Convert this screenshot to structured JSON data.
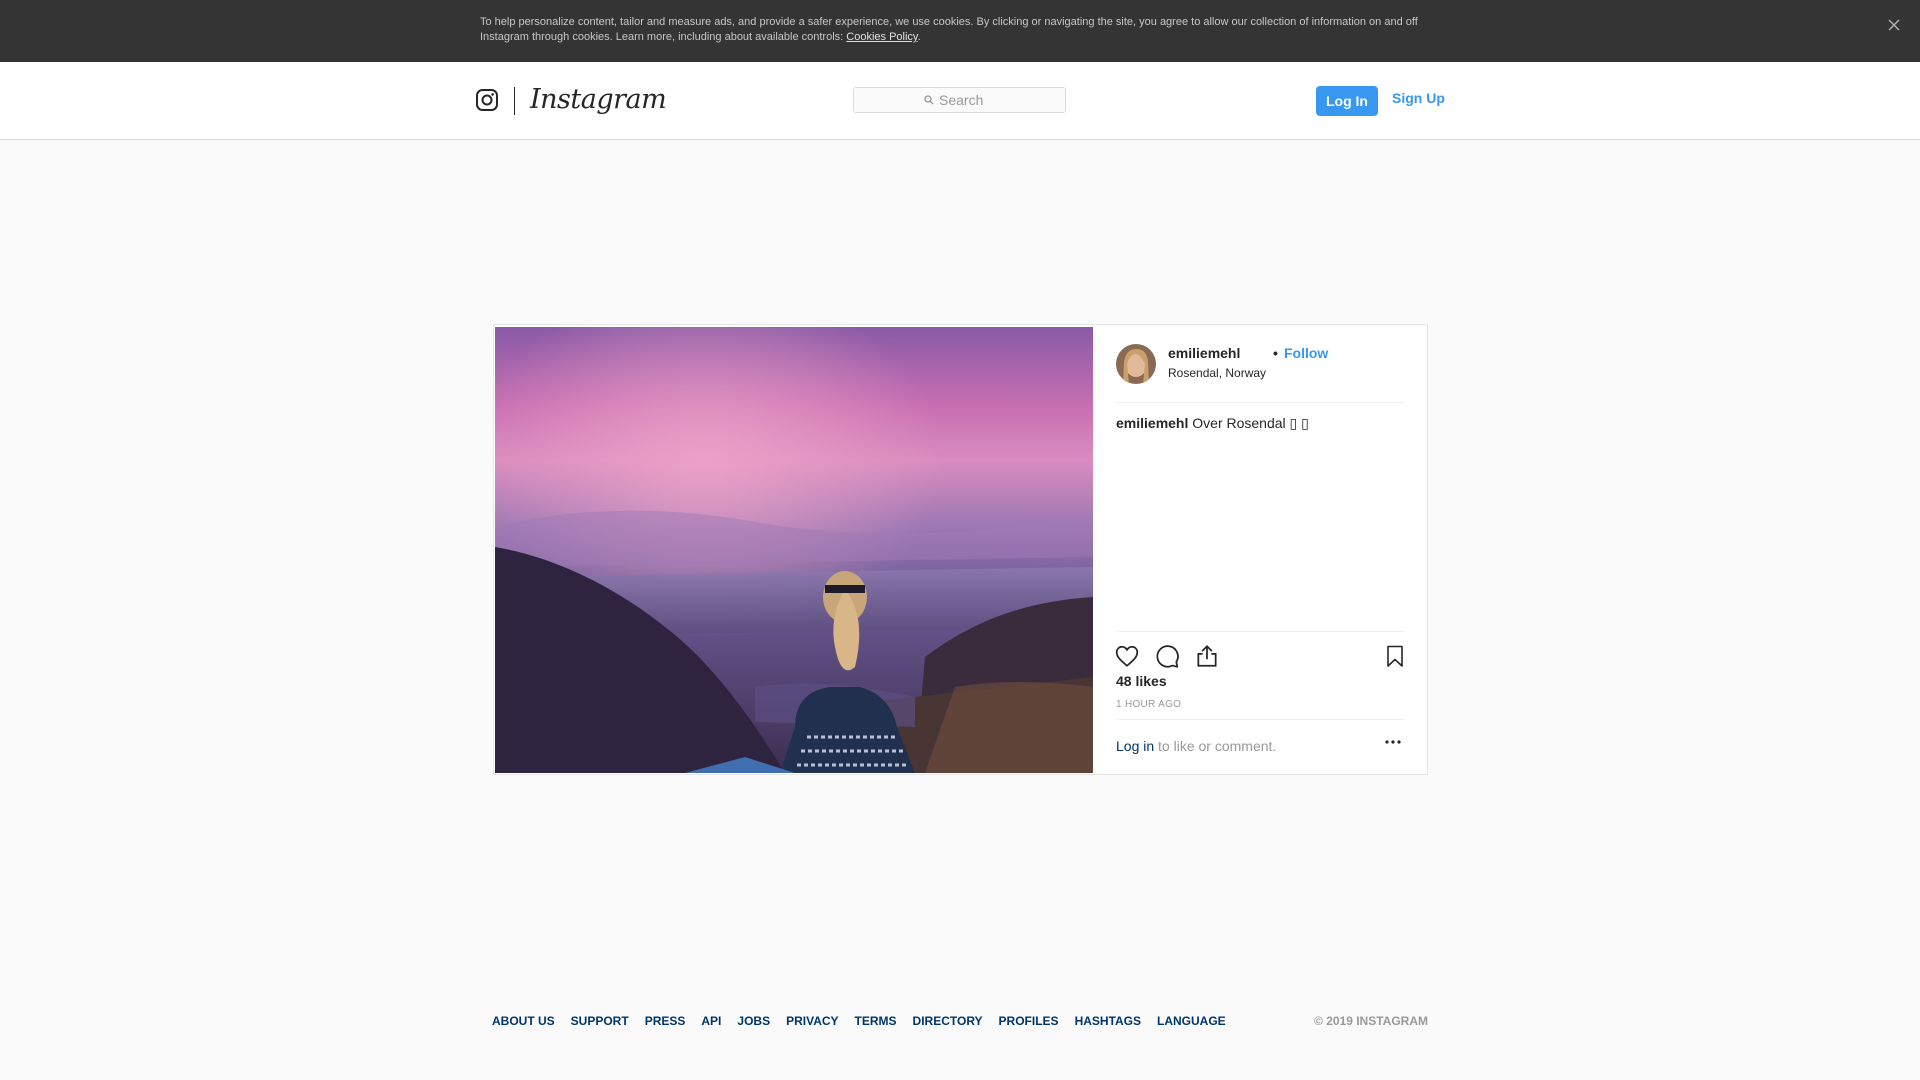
{
  "cookie_banner": {
    "text": "To help personalize content, tailor and measure ads, and provide a safer experience, we use cookies. By clicking or navigating the site, you agree to allow our collection of information on and off Instagram through cookies. Learn more, including about available controls: ",
    "link_label": "Cookies Policy",
    "suffix": ".",
    "close_icon": "close-icon"
  },
  "nav": {
    "logo_icon": "instagram-glyph-icon",
    "wordmark": "Instagram",
    "search_placeholder": "Search",
    "search_icon": "search-icon",
    "login_label": "Log In",
    "signup_label": "Sign Up"
  },
  "post": {
    "username": "emiliemehl",
    "separator": "•",
    "follow_label": "Follow",
    "location": "Rosendal, Norway",
    "caption_user": "emiliemehl",
    "caption_text": " Over Rosendal ▯ ▯",
    "likes": "48 likes",
    "time_ago": "1 HOUR AGO",
    "login_link": "Log in",
    "login_suffix": " to like or comment.",
    "icons": {
      "like": "heart-icon",
      "comment": "comment-icon",
      "share": "share-icon",
      "save": "bookmark-icon",
      "more": "more-options-icon"
    }
  },
  "footer": {
    "links": [
      "ABOUT US",
      "SUPPORT",
      "PRESS",
      "API",
      "JOBS",
      "PRIVACY",
      "TERMS",
      "DIRECTORY",
      "PROFILES",
      "HASHTAGS",
      "LANGUAGE"
    ],
    "copyright": "© 2019 INSTAGRAM"
  },
  "colors": {
    "accent": "#3897f0",
    "link_dark": "#003569",
    "banner_bg": "#343434",
    "page_bg": "#fafafa"
  }
}
